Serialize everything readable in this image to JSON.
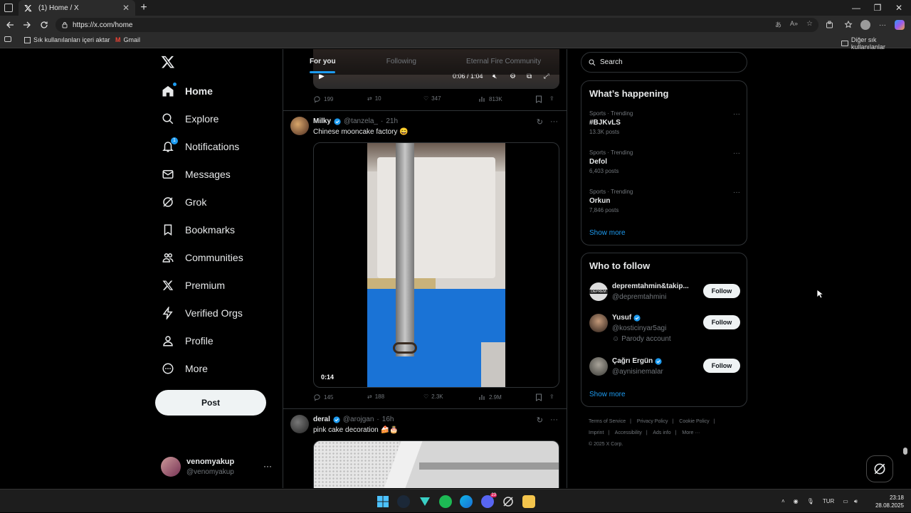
{
  "browser": {
    "tab_title": "(1) Home / X",
    "url": "https://x.com/home",
    "bookmarks": [
      "Sık kullanılanları içeri aktar",
      "Gmail"
    ],
    "other_favorites": "Diğer sık kullanılanlar"
  },
  "sidebar": {
    "items": [
      {
        "label": "Home",
        "icon": "home-icon"
      },
      {
        "label": "Explore",
        "icon": "search-icon"
      },
      {
        "label": "Notifications",
        "icon": "bell-icon",
        "badge": "1"
      },
      {
        "label": "Messages",
        "icon": "mail-icon"
      },
      {
        "label": "Grok",
        "icon": "grok-icon"
      },
      {
        "label": "Bookmarks",
        "icon": "bookmark-icon"
      },
      {
        "label": "Communities",
        "icon": "communities-icon"
      },
      {
        "label": "Premium",
        "icon": "x-icon"
      },
      {
        "label": "Verified Orgs",
        "icon": "lightning-icon"
      },
      {
        "label": "Profile",
        "icon": "person-icon"
      },
      {
        "label": "More",
        "icon": "more-circle-icon"
      }
    ],
    "post_label": "Post",
    "account": {
      "name": "venomyakup",
      "handle": "@venomyakup",
      "more": "···"
    }
  },
  "timeline": {
    "tabs": [
      "For you",
      "Following",
      "Eternal Fire Community"
    ],
    "prev_tweet": {
      "video_time": "0:06 / 1:04",
      "actions": {
        "replies": "199",
        "reposts": "10",
        "likes": "347",
        "views": "813K"
      }
    },
    "tweets": [
      {
        "name": "Milky",
        "handle": "@tanzela_",
        "time": "21h",
        "text": "Chinese mooncake factory 😄",
        "duration": "0:14",
        "actions": {
          "replies": "145",
          "reposts": "188",
          "likes": "2.3K",
          "views": "2.9M"
        }
      },
      {
        "name": "deral",
        "handle": "@arojgan",
        "time": "16h",
        "text": "pink cake decoration 🍰🎂"
      }
    ],
    "more_dots": "···",
    "sep": "·"
  },
  "right": {
    "search_placeholder": "Search",
    "trends_title": "What’s happening",
    "trends": [
      {
        "meta": "Sports · Trending",
        "name": "#BJKvLS",
        "posts": "13.3K posts"
      },
      {
        "meta": "Sports · Trending",
        "name": "Defol",
        "posts": "6,403 posts"
      },
      {
        "meta": "Sports · Trending",
        "name": "Orkun",
        "posts": "7,846 posts"
      }
    ],
    "show_more": "Show more",
    "follow_title": "Who to follow",
    "follow": [
      {
        "name": "depremtahmin&takip...",
        "handle": "@depremtahmini",
        "verified": false,
        "note": ""
      },
      {
        "name": "Yusuf",
        "handle": "@kosticinyar5agi",
        "verified": true,
        "note": "Parody account"
      },
      {
        "name": "Çağrı Ergün",
        "handle": "@aynisinemalar",
        "verified": true,
        "note": ""
      }
    ],
    "follow_label": "Follow",
    "footer": [
      "Terms of Service",
      "|",
      "Privacy Policy",
      "|",
      "Cookie Policy",
      "|",
      "Imprint",
      "|",
      "Accessibility",
      "|",
      "Ads info",
      "|",
      "More ···",
      "© 2025 X Corp."
    ]
  },
  "taskbar": {
    "lang": "TUR",
    "time": "23:18",
    "date": "28.08.2025",
    "discord_badge": "23"
  },
  "colors": {
    "accent": "#1d9bf0",
    "border": "#2f3336",
    "muted": "#71767b"
  }
}
